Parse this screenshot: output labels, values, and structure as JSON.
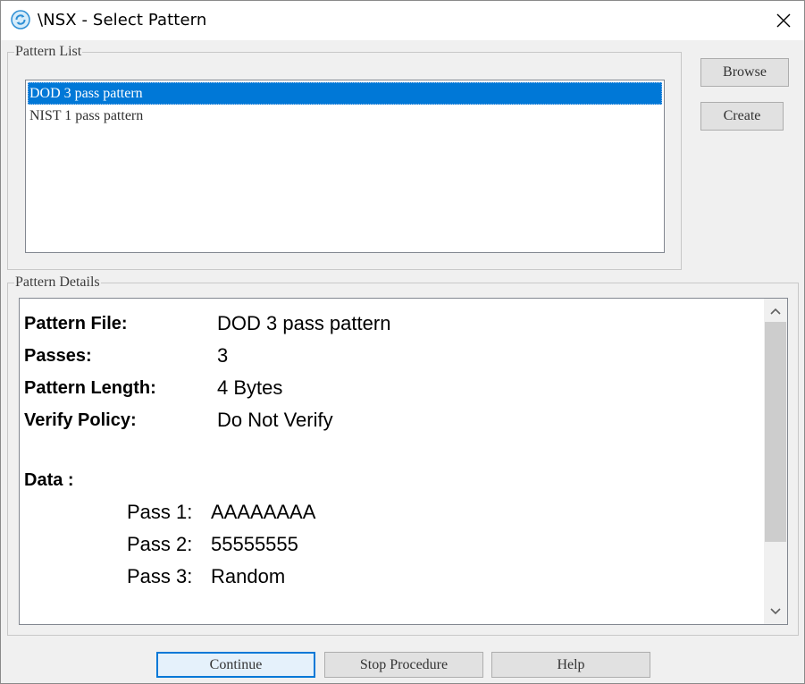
{
  "window": {
    "title": "\\NSX - Select Pattern"
  },
  "pattern_list": {
    "group_label": "Pattern List",
    "items": [
      {
        "label": "DOD 3 pass pattern",
        "selected": true
      },
      {
        "label": "NIST 1 pass pattern",
        "selected": false
      }
    ]
  },
  "side_buttons": {
    "browse_label": "Browse",
    "create_label": "Create"
  },
  "pattern_details": {
    "group_label": "Pattern Details",
    "fields": [
      {
        "key": "Pattern File:",
        "value": "DOD 3 pass pattern"
      },
      {
        "key": "Passes:",
        "value": "3"
      },
      {
        "key": "Pattern Length:",
        "value": "4 Bytes"
      },
      {
        "key": "Verify Policy:",
        "value": "Do Not Verify"
      }
    ],
    "data_label": "Data :",
    "passes": [
      {
        "key": "Pass 1:",
        "value": "AAAAAAAA"
      },
      {
        "key": "Pass 2:",
        "value": "55555555"
      },
      {
        "key": "Pass 3:",
        "value": "Random"
      }
    ]
  },
  "footer_buttons": {
    "continue_label": "Continue",
    "stop_label": "Stop Procedure",
    "help_label": "Help"
  },
  "colors": {
    "selection": "#0078d7",
    "background": "#f0f0f0",
    "scroll_thumb": "#cdcdcd"
  },
  "icons": {
    "app": "sync-circle-icon",
    "close": "close-icon",
    "scroll_up": "chevron-up-icon",
    "scroll_down": "chevron-down-icon"
  }
}
